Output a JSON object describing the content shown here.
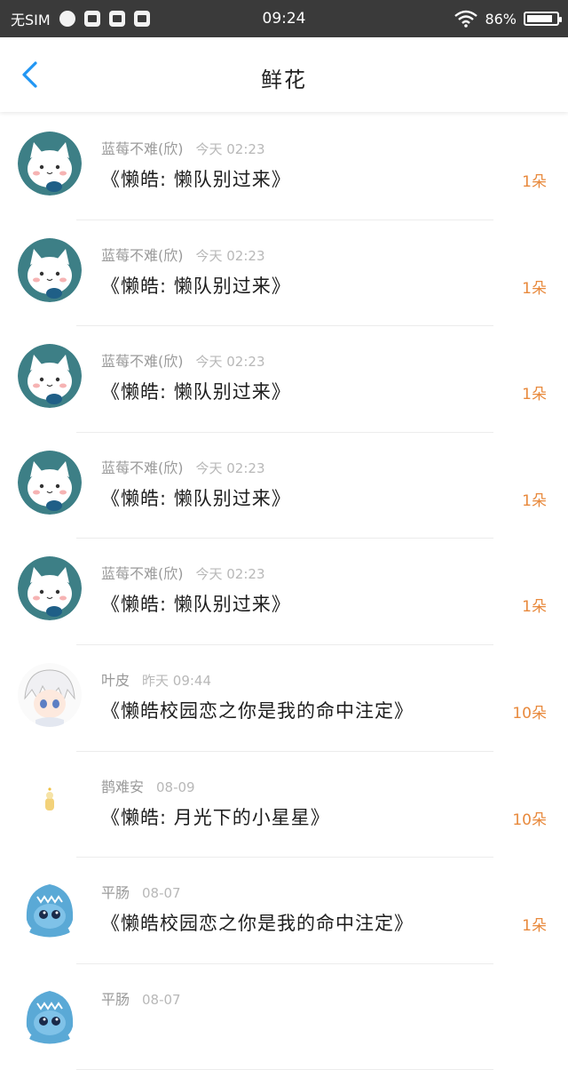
{
  "status_bar": {
    "carrier": "无SIM",
    "time": "09:24",
    "battery": "86%",
    "battery_level": 0.86
  },
  "header": {
    "title": "鲜花",
    "back_icon": "chevron-left-icon",
    "accent": "#2196F3"
  },
  "colors": {
    "count": "#e8893c"
  },
  "records": [
    {
      "user": "蓝莓不难(欣)",
      "time": "今天 02:23",
      "book": "《懒皓:  懒队别过来》",
      "count": "1朵",
      "avatar": "cat-teal"
    },
    {
      "user": "蓝莓不难(欣)",
      "time": "今天 02:23",
      "book": "《懒皓:  懒队别过来》",
      "count": "1朵",
      "avatar": "cat-teal"
    },
    {
      "user": "蓝莓不难(欣)",
      "time": "今天 02:23",
      "book": "《懒皓:  懒队别过来》",
      "count": "1朵",
      "avatar": "cat-teal"
    },
    {
      "user": "蓝莓不难(欣)",
      "time": "今天 02:23",
      "book": "《懒皓:  懒队别过来》",
      "count": "1朵",
      "avatar": "cat-teal"
    },
    {
      "user": "蓝莓不难(欣)",
      "time": "今天 02:23",
      "book": "《懒皓:  懒队别过来》",
      "count": "1朵",
      "avatar": "cat-teal"
    },
    {
      "user": "叶皮",
      "time": "昨天 09:44",
      "book": "《懒皓校园恋之你是我的命中注定》",
      "count": "10朵",
      "avatar": "anime-white-hair"
    },
    {
      "user": "鹊难安",
      "time": "08-09",
      "book": "《懒皓:  月光下的小星星》",
      "count": "10朵",
      "avatar": "small-figure"
    },
    {
      "user": "平肠",
      "time": "08-07",
      "book": "《懒皓校园恋之你是我的命中注定》",
      "count": "1朵",
      "avatar": "shark-hood"
    },
    {
      "user": "平肠",
      "time": "08-07",
      "book": "",
      "count": "",
      "avatar": "shark-hood"
    }
  ]
}
